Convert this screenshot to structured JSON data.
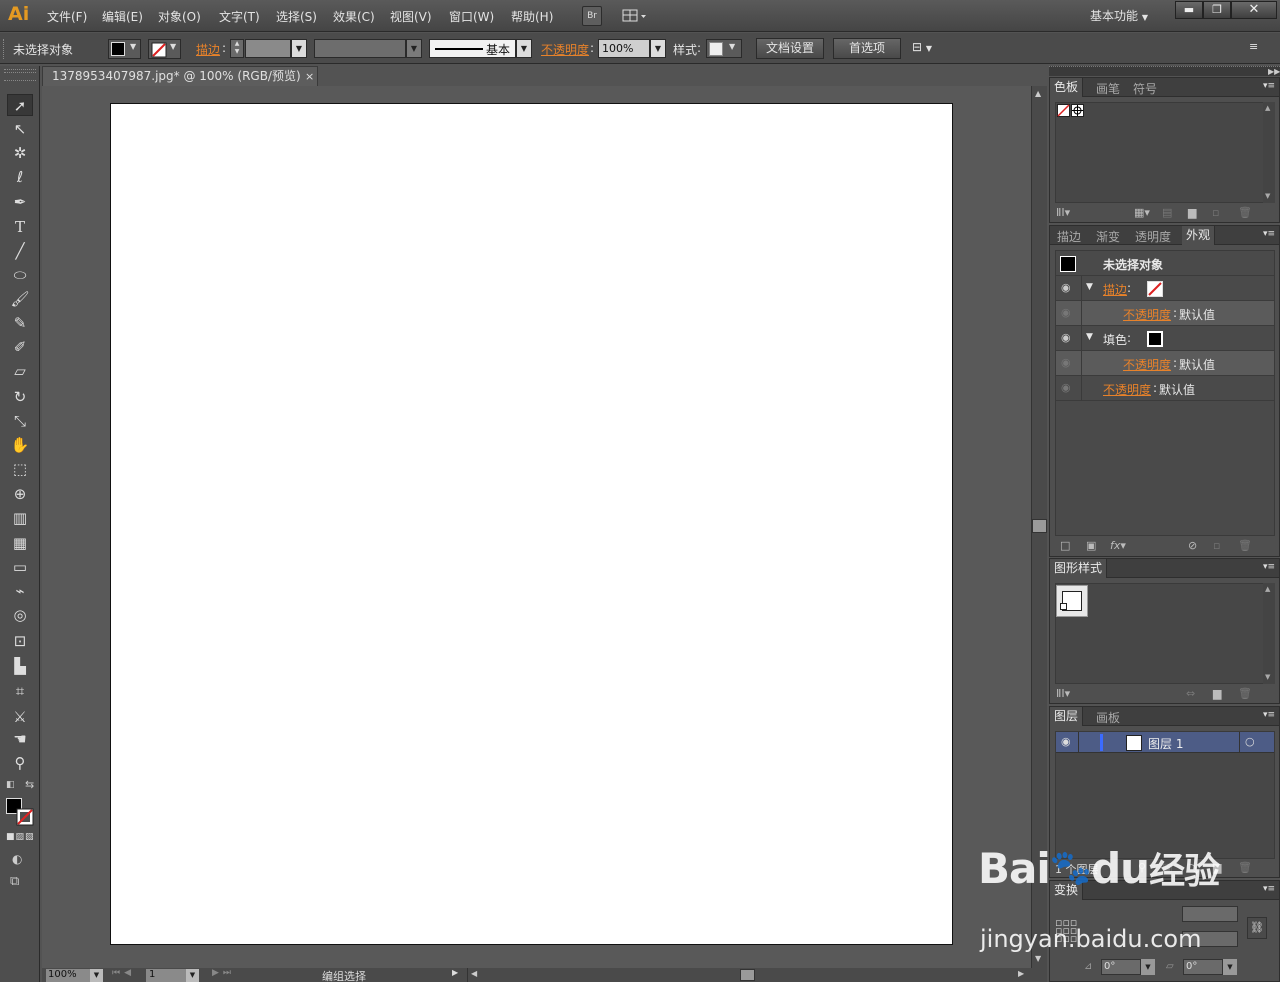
{
  "app": {
    "logo": "Ai"
  },
  "menu": [
    {
      "label": "文件(F)",
      "name": "menu-file"
    },
    {
      "label": "编辑(E)",
      "name": "menu-edit"
    },
    {
      "label": "对象(O)",
      "name": "menu-object"
    },
    {
      "label": "文字(T)",
      "name": "menu-type"
    },
    {
      "label": "选择(S)",
      "name": "menu-select"
    },
    {
      "label": "效果(C)",
      "name": "menu-effect"
    },
    {
      "label": "视图(V)",
      "name": "menu-view"
    },
    {
      "label": "窗口(W)",
      "name": "menu-window"
    },
    {
      "label": "帮助(H)",
      "name": "menu-help"
    }
  ],
  "bridge_label": "Br",
  "workspace_label": "基本功能",
  "control": {
    "selection_status": "未选择对象",
    "stroke_label": "描边",
    "brush_label": "基本",
    "opacity_label": "不透明度",
    "opacity_value": "100%",
    "style_label": "样式",
    "doc_setup_button": "文档设置",
    "prefs_button": "首选项"
  },
  "document": {
    "tab_title": "1378953407987.jpg* @ 100% (RGB/预览)",
    "close": "×"
  },
  "status": {
    "zoom": "100%",
    "artboard_num": "1",
    "status_text": "编组选择"
  },
  "panels": {
    "swatches": {
      "tabs": [
        "色板",
        "画笔",
        "符号"
      ]
    },
    "appearance": {
      "tabs": [
        "描边",
        "渐变",
        "透明度",
        "外观"
      ],
      "title": "未选择对象",
      "stroke_label": "描边",
      "fill_label": "填色",
      "opacity_label": "不透明度",
      "default_value": "默认值"
    },
    "graphic_styles": {
      "tabs": [
        "图形样式"
      ]
    },
    "layers": {
      "tabs": [
        "图层",
        "画板"
      ],
      "layer_name": "图层 1",
      "footer": "1 个图层"
    },
    "transform": {
      "tab": "变换",
      "angle1": "0°",
      "angle2": "0°"
    }
  },
  "watermark": {
    "brand": "Bai",
    "brand2": "du",
    "suffix": "经验",
    "url": "jingyan.baidu.com"
  },
  "colors": {
    "accent": "#e8822a",
    "logo": "#e49a22",
    "layer_highlight": "#4d5c86"
  }
}
